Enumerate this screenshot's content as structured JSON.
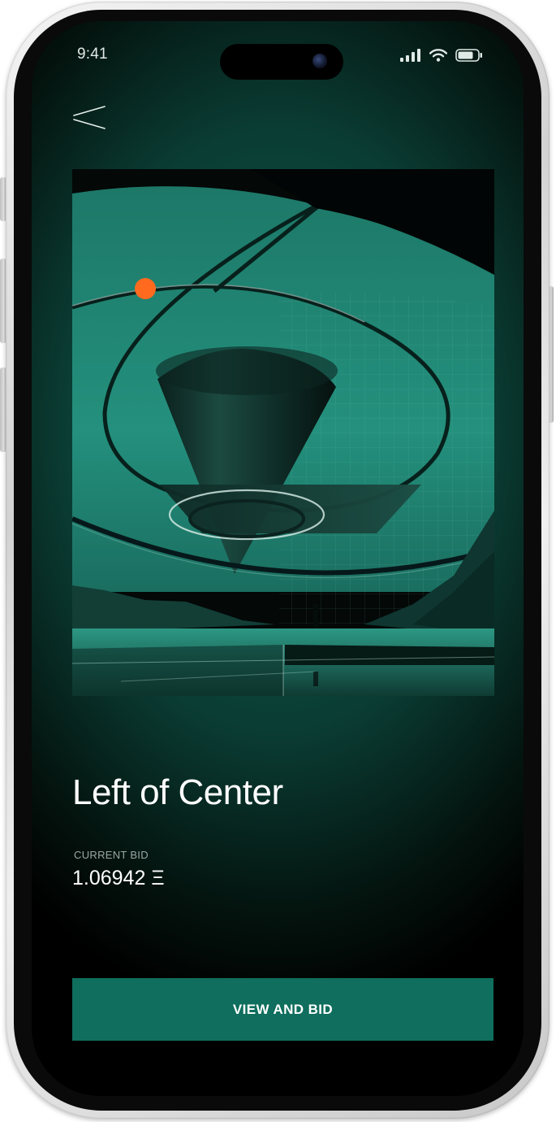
{
  "status_bar": {
    "time": "9:41"
  },
  "nav": {
    "back_icon": "back-arrow-icon"
  },
  "artwork": {
    "title": "Left of Center"
  },
  "auction": {
    "current_bid_label": "CURRENT BID",
    "current_bid_value": "1.06942 Ξ"
  },
  "cta": {
    "label": "VIEW AND BID"
  },
  "colors": {
    "accent": "#0f6e5d",
    "background": "#000000",
    "glow": "#0f5a4b",
    "art_teal": "#24907d",
    "sun": "#ff6a1f"
  }
}
